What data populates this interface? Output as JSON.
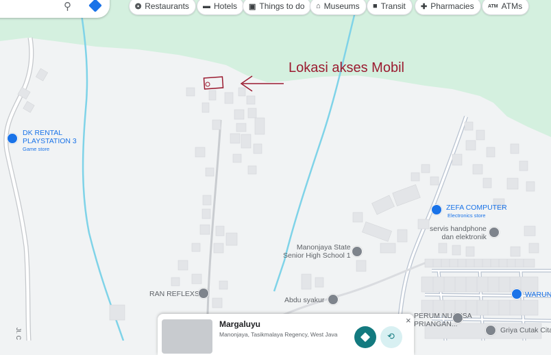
{
  "map": {
    "colors": {
      "land": "#f1f3f4",
      "park": "#d4f0df",
      "water": "#7fd3e8",
      "road": "#dadce0",
      "building": "#e3e5e8"
    }
  },
  "search": {
    "search_icon": "search-icon",
    "directions_icon": "directions-icon"
  },
  "chips": [
    {
      "icon": "❂",
      "label": "Restaurants"
    },
    {
      "icon": "▬",
      "label": "Hotels"
    },
    {
      "icon": "▣",
      "label": "Things to do"
    },
    {
      "icon": "⌂",
      "label": "Museums"
    },
    {
      "icon": "■",
      "label": "Transit"
    },
    {
      "icon": "✚",
      "label": "Pharmacies"
    },
    {
      "icon": "ATM",
      "label": "ATMs"
    }
  ],
  "annotation": {
    "text": "Lokasi akses Mobil",
    "color": "#9b1b30"
  },
  "pois": {
    "dk_rental": {
      "line1": "DK RENTAL",
      "line2": "PLAYSTATION 3",
      "category": "Game store"
    },
    "zefa": {
      "name": "ZEFA COMPUTER",
      "category": "Electronics store"
    },
    "servis": {
      "line1": "servis handphone",
      "line2": "dan elektronik"
    },
    "manonjaya_school": {
      "line1": "Manonjaya State",
      "line2": "Senior High School 1"
    },
    "ran_reflexsi": {
      "name": "RAN REFLEXSI"
    },
    "abdu": {
      "name": "Abdu syakur"
    },
    "perum": {
      "line1": "PERUM NUANSA",
      "line2": "PRIANGAN..."
    },
    "warung": {
      "name": "WARUNG"
    },
    "griya": {
      "name": "Griya Cutak Cita"
    },
    "road_label": {
      "name": "Jl. C"
    }
  },
  "place_card": {
    "title": "Margaluyu",
    "address": "Manonjaya, Tasikmalaya Regency, West Java",
    "close": "×"
  }
}
